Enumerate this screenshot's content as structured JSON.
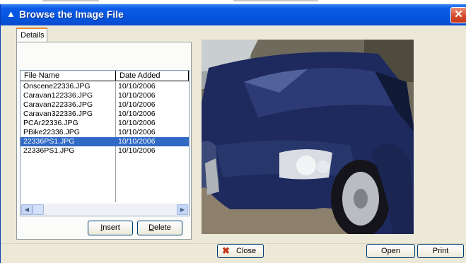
{
  "window": {
    "title": "Browse the Image File"
  },
  "tabs": [
    {
      "label": "Details"
    }
  ],
  "file_list": {
    "columns": [
      "File Name",
      "Date Added"
    ],
    "rows": [
      {
        "name": "Onscene22336.JPG",
        "date": "10/10/2006",
        "selected": false
      },
      {
        "name": "Caravan122336.JPG",
        "date": "10/10/2006",
        "selected": false
      },
      {
        "name": "Caravan222336.JPG",
        "date": "10/10/2006",
        "selected": false
      },
      {
        "name": "Caravan322336.JPG",
        "date": "10/10/2006",
        "selected": false
      },
      {
        "name": "PCAr22336.JPG",
        "date": "10/10/2006",
        "selected": false
      },
      {
        "name": "PBike22336.JPG",
        "date": "10/10/2006",
        "selected": false
      },
      {
        "name": "22336PS1.JPG",
        "date": "10/10/2006",
        "selected": true
      },
      {
        "name": "22336PS1.JPG",
        "date": "10/10/2006",
        "selected": false
      }
    ]
  },
  "buttons": {
    "insert": {
      "label": "Insert",
      "accel": "I",
      "rest": "nsert"
    },
    "delete": {
      "label": "Delete",
      "accel": "D",
      "rest": "elete"
    },
    "close": {
      "label": "Close"
    },
    "open": {
      "label": "Open"
    },
    "print": {
      "label": "Print"
    }
  },
  "icons": {
    "title": "triangle-app-icon",
    "close_button": "red-x-icon"
  },
  "colors": {
    "titlebar": "#0556de",
    "selection": "#316ac5",
    "window_bg": "#ece9d8",
    "close_red": "#d3482a"
  }
}
